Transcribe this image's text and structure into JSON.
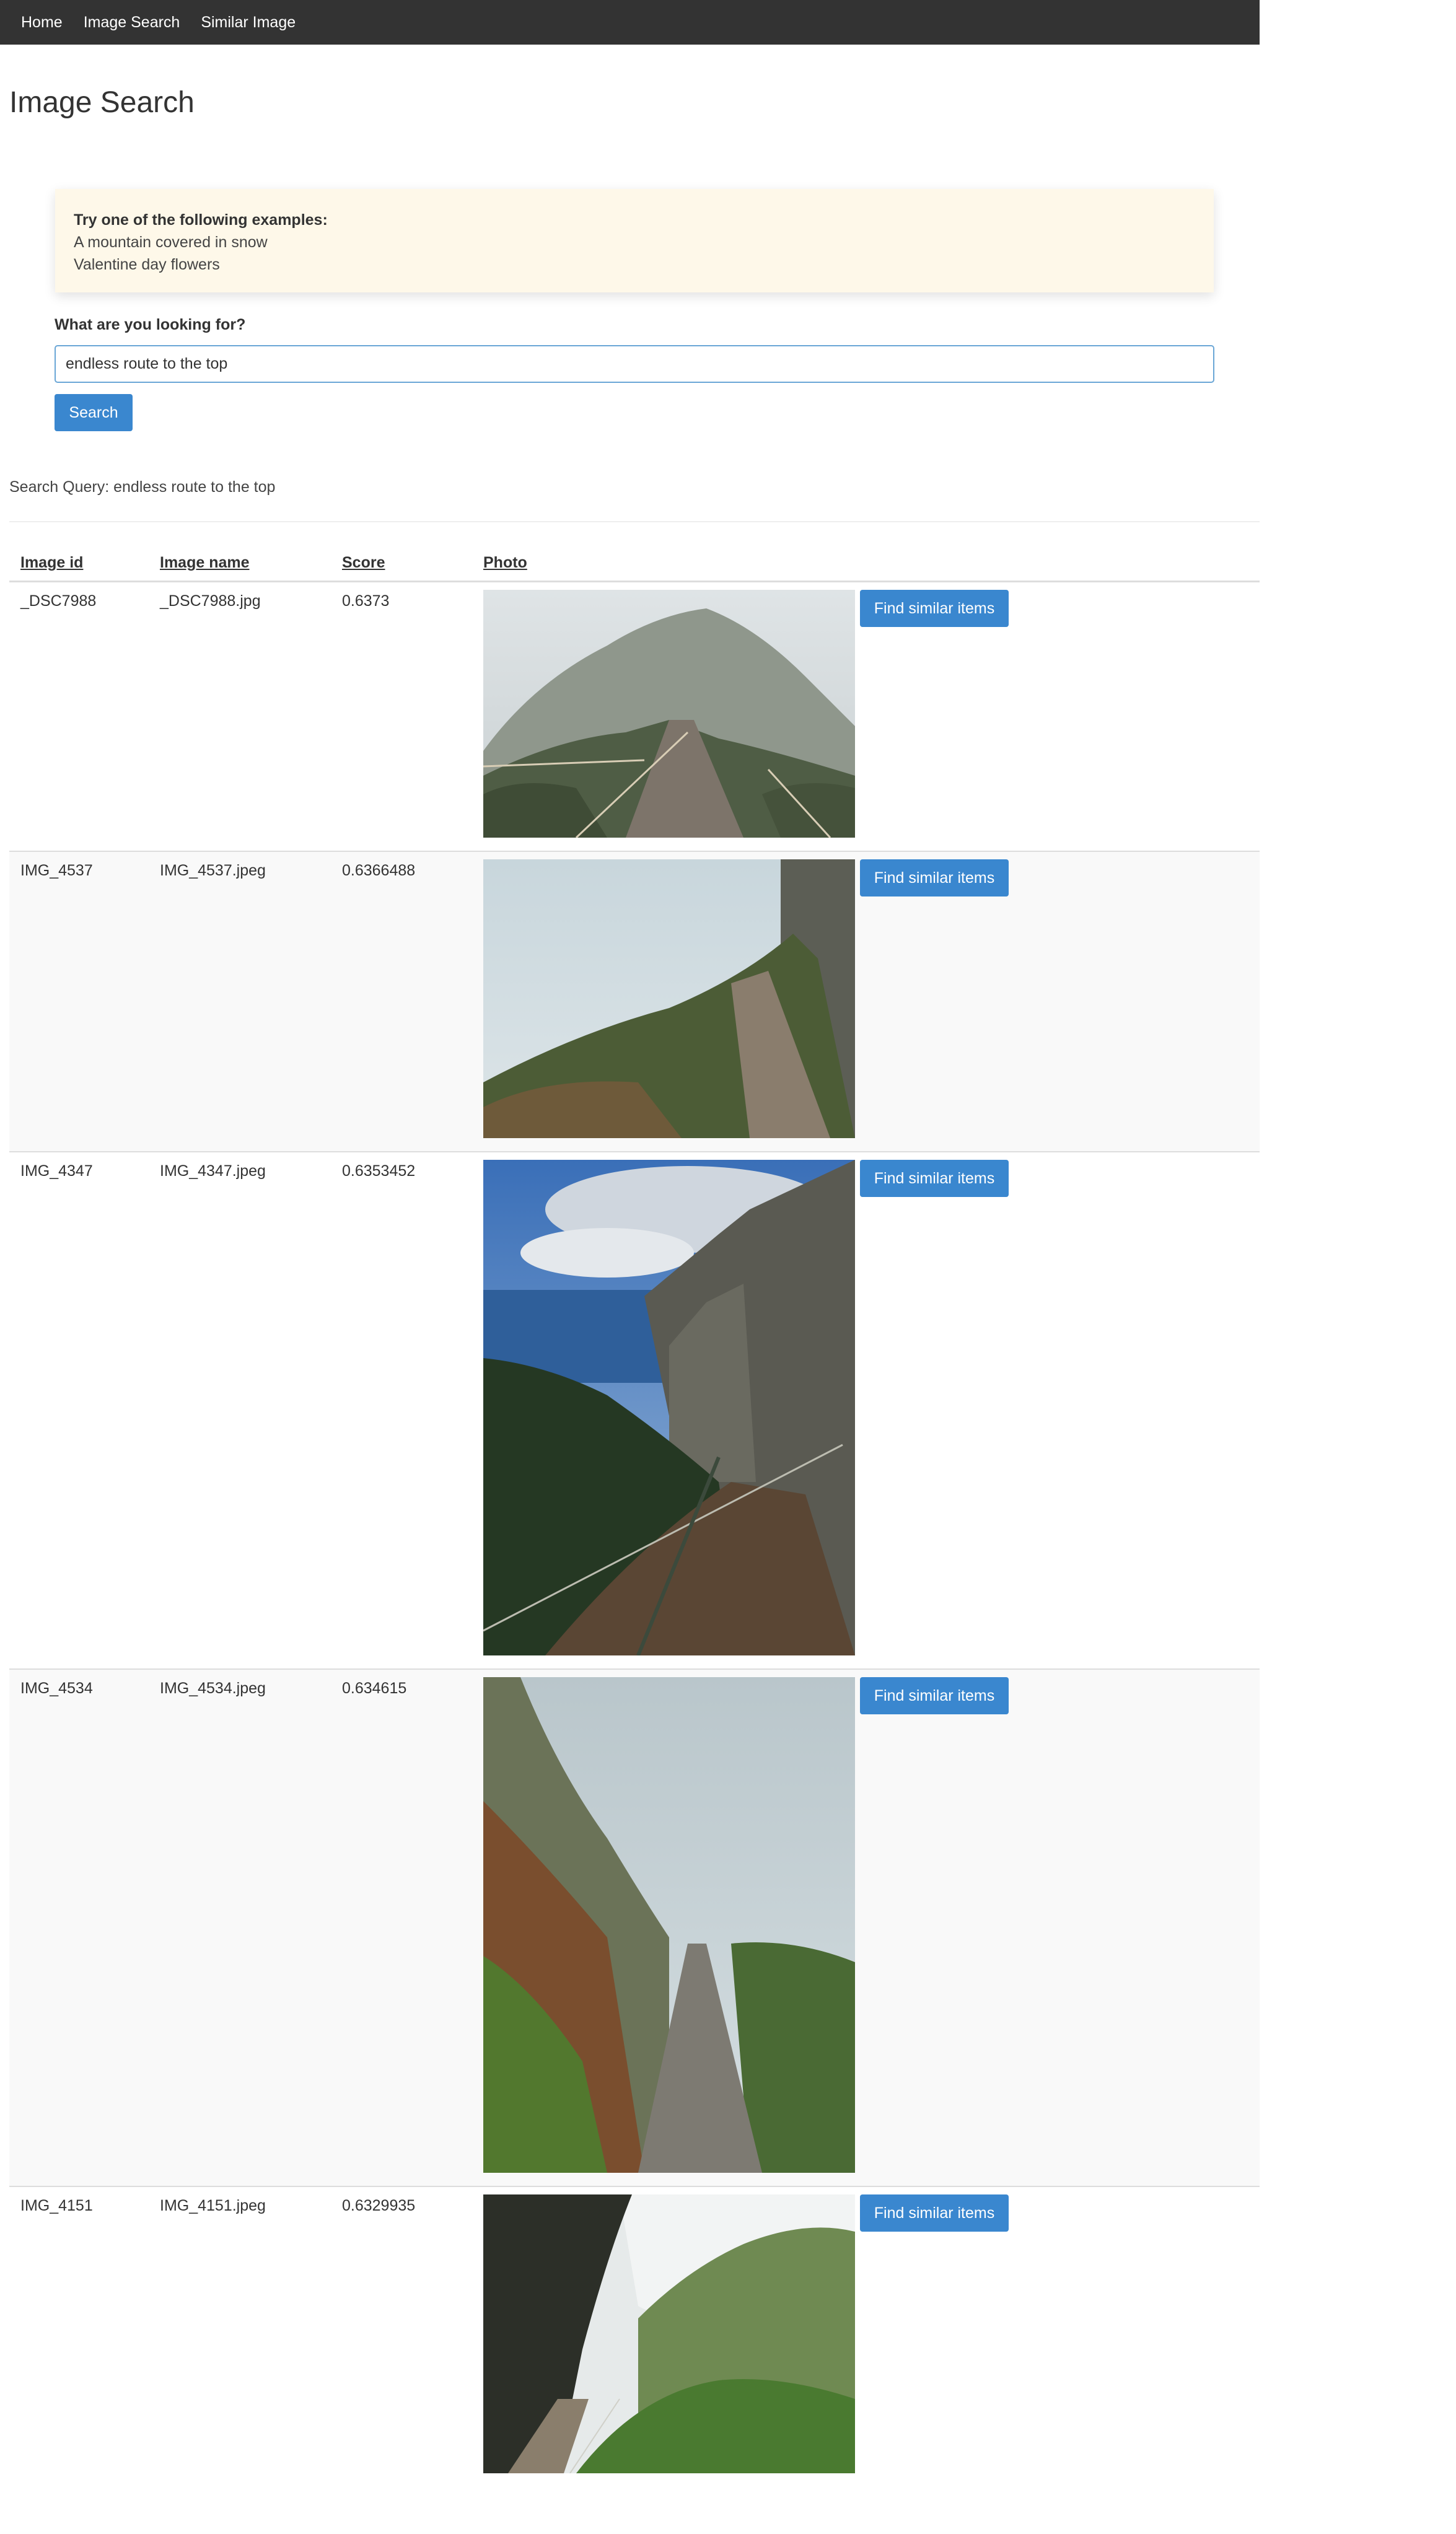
{
  "nav": {
    "items": [
      {
        "label": "Home"
      },
      {
        "label": "Image Search"
      },
      {
        "label": "Similar Image"
      }
    ]
  },
  "page": {
    "title": "Image Search"
  },
  "examples": {
    "heading": "Try one of the following examples:",
    "items": [
      "A mountain covered in snow",
      "Valentine day flowers"
    ]
  },
  "search": {
    "label": "What are you looking for?",
    "value": "endless route to the top",
    "button_label": "Search"
  },
  "query_echo": "Search Query: endless route to the top",
  "table": {
    "headers": {
      "id": "Image id",
      "name": "Image name",
      "score": "Score",
      "photo": "Photo"
    },
    "action_label": "Find similar items",
    "rows": [
      {
        "id": "_DSC7988",
        "name": "_DSC7988.jpg",
        "score": "0.6373",
        "photo": "misty-mountain-ridge-path"
      },
      {
        "id": "IMG_4537",
        "name": "IMG_4537.jpeg",
        "score": "0.6366488",
        "photo": "cliffside-stone-path-fog"
      },
      {
        "id": "IMG_4347",
        "name": "IMG_4347.jpeg",
        "score": "0.6353452",
        "photo": "coastal-cliff-trail-railing"
      },
      {
        "id": "IMG_4534",
        "name": "IMG_4534.jpeg",
        "score": "0.634615",
        "photo": "cobblestone-trail-into-fog"
      },
      {
        "id": "IMG_4151",
        "name": "IMG_4151.jpeg",
        "score": "0.6329935",
        "photo": "green-valley-levada-path"
      }
    ]
  },
  "colors": {
    "navbar": "#333333",
    "accent": "#3a87cf",
    "callout": "#fef8e9"
  }
}
